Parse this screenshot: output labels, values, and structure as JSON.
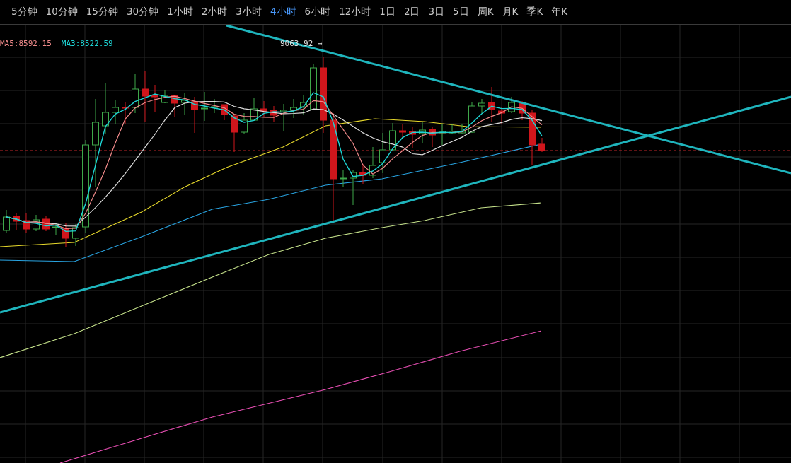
{
  "toolbar": {
    "tabs": [
      {
        "label": "5分钟",
        "selected": false
      },
      {
        "label": "10分钟",
        "selected": false
      },
      {
        "label": "15分钟",
        "selected": false
      },
      {
        "label": "30分钟",
        "selected": false
      },
      {
        "label": "1小时",
        "selected": false
      },
      {
        "label": "2小时",
        "selected": false
      },
      {
        "label": "3小时",
        "selected": false
      },
      {
        "label": "4小时",
        "selected": true
      },
      {
        "label": "6小时",
        "selected": false
      },
      {
        "label": "12小时",
        "selected": false
      },
      {
        "label": "1日",
        "selected": false
      },
      {
        "label": "2日",
        "selected": false
      },
      {
        "label": "3日",
        "selected": false
      },
      {
        "label": "5日",
        "selected": false
      },
      {
        "label": "周K",
        "selected": false
      },
      {
        "label": "月K",
        "selected": false
      },
      {
        "label": "季K",
        "selected": false
      },
      {
        "label": "年K",
        "selected": false
      }
    ]
  },
  "chart": {
    "legend": [
      {
        "label": "MA5:8592.15",
        "color": "#f08a8a"
      },
      {
        "label": "MA3:8522.59",
        "color": "#1ed6d6"
      }
    ],
    "high_marker": "9063.92 →"
  }
}
